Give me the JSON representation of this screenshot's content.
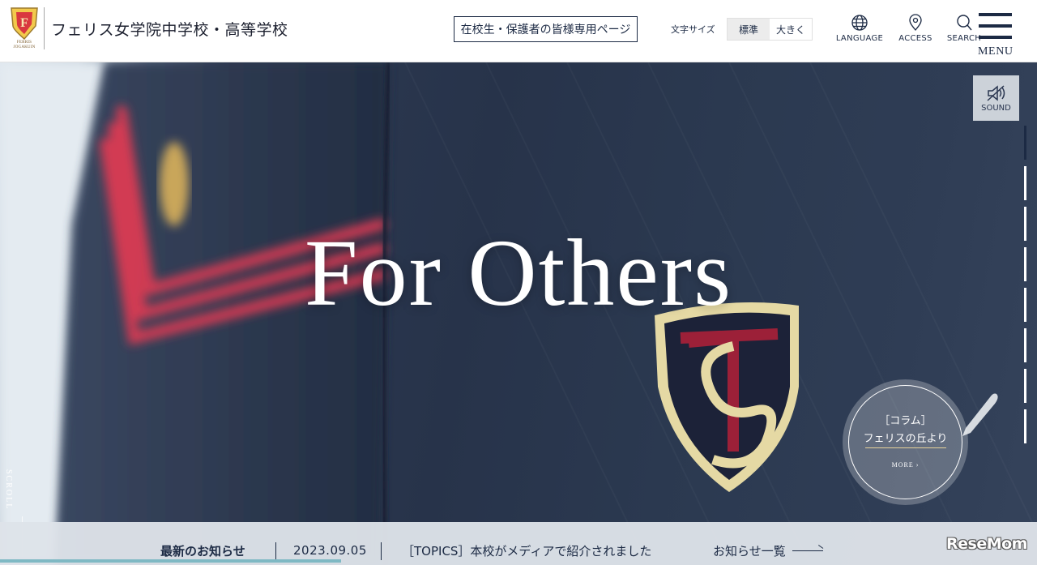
{
  "header": {
    "school_name": "フェリス女学院中学校・高等学校",
    "logo_text_line1": "FERRIS",
    "logo_text_line2": "JOGAKUIN",
    "parents_link": "在校生・保護者の皆様専用ページ",
    "font_size": {
      "label": "文字サイズ",
      "options": [
        "標準",
        "大きく"
      ],
      "selected": "標準"
    },
    "nav": {
      "language": "LANGUAGE",
      "access": "ACCESS",
      "search": "SEARCH",
      "menu": "MENU"
    }
  },
  "hero": {
    "tagline": "For Others",
    "sound_label": "SOUND",
    "scroll_label": "SCROLL",
    "slide_count": 8,
    "active_slide": 1,
    "column": {
      "title_line1": "［コラム］",
      "title_line2": "フェリスの丘より",
      "more": "MORE ›"
    }
  },
  "news": {
    "label": "最新のお知らせ",
    "date": "2023.09.05",
    "title": "［TOPICS］本校がメディアで紹介されました",
    "all_link": "お知らせ一覧"
  },
  "watermark": "ReseMom",
  "colors": {
    "navy": "#1c2a44",
    "accent_stripe": "#d23b52",
    "progress": "#7fb9c4"
  }
}
